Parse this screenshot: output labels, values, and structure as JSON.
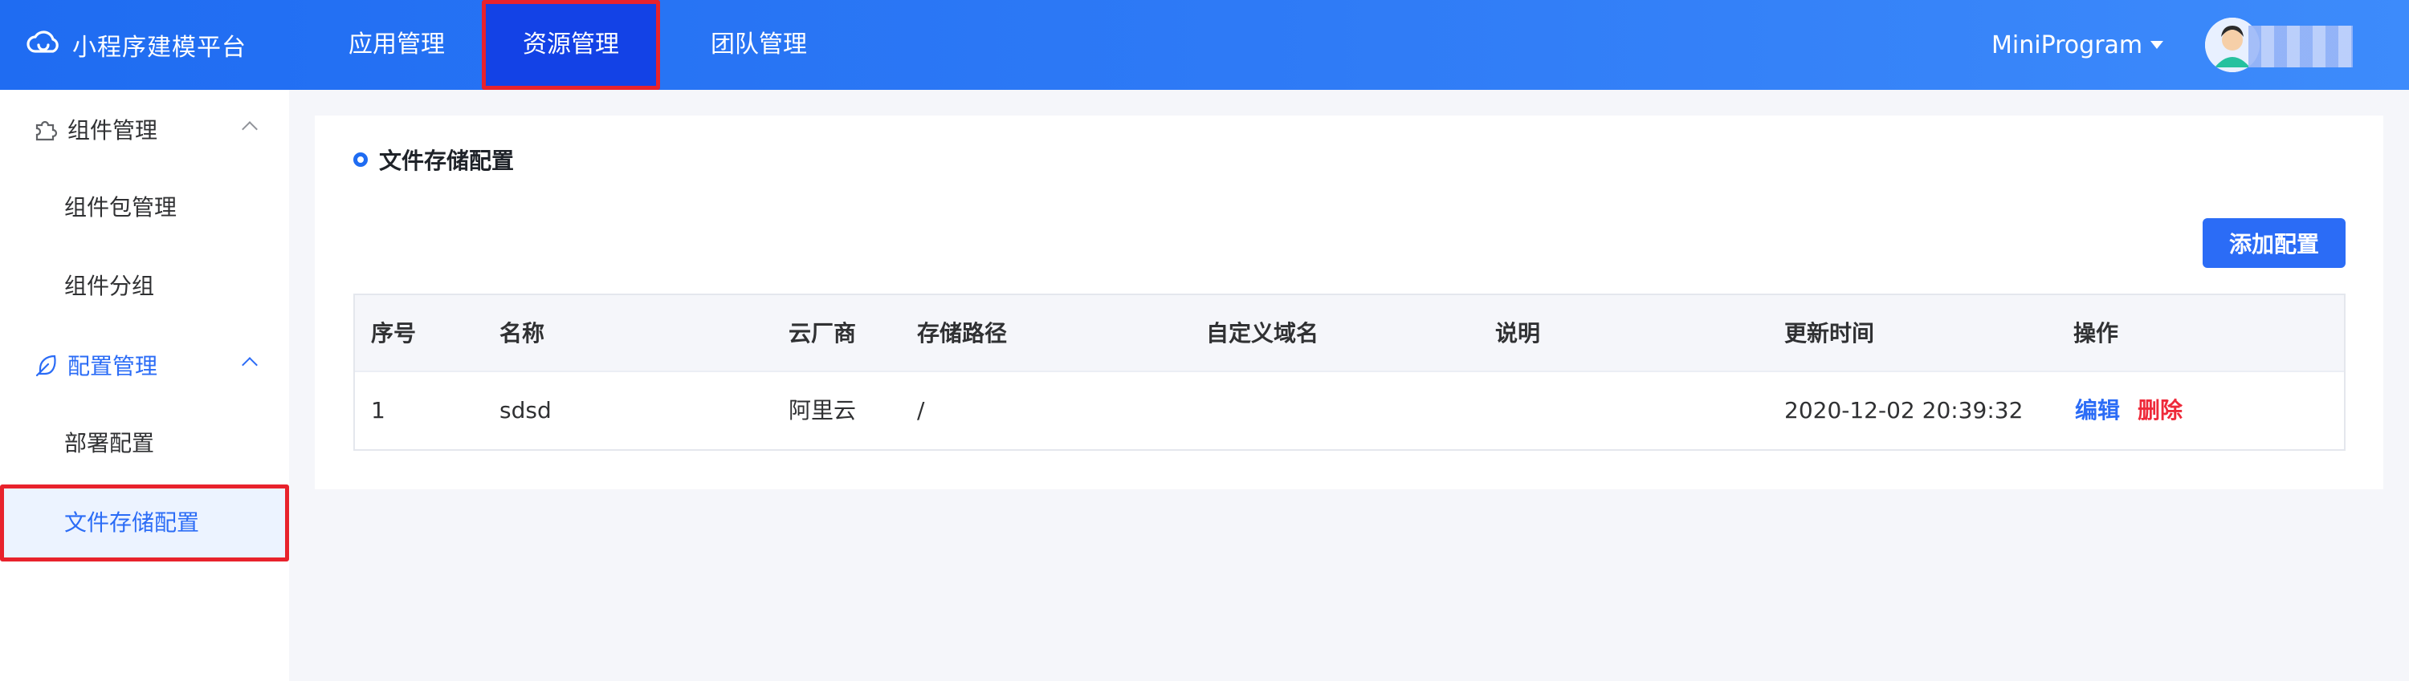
{
  "app": {
    "logo_text": "小程序建模平台"
  },
  "nav": {
    "items": [
      {
        "label": "应用管理"
      },
      {
        "label": "资源管理",
        "active": true
      },
      {
        "label": "团队管理"
      }
    ],
    "user_menu": "MiniProgram"
  },
  "sidebar": {
    "groups": [
      {
        "label": "组件管理",
        "icon": "puzzle-icon",
        "expanded": true,
        "items": [
          {
            "label": "组件包管理"
          },
          {
            "label": "组件分组"
          }
        ]
      },
      {
        "label": "配置管理",
        "icon": "feather-icon",
        "expanded": true,
        "items": [
          {
            "label": "部署配置"
          },
          {
            "label": "文件存储配置",
            "active": true
          }
        ]
      }
    ]
  },
  "main": {
    "title": "文件存储配置",
    "add_button": "添加配置",
    "table": {
      "columns": [
        "序号",
        "名称",
        "云厂商",
        "存储路径",
        "自定义域名",
        "说明",
        "更新时间",
        "操作"
      ],
      "rows": [
        {
          "index": "1",
          "name": "sdsd",
          "vendor": "阿里云",
          "path": "/",
          "domain": "",
          "desc": "",
          "updated": "2020-12-02 20:39:32",
          "actions": {
            "edit": "编辑",
            "delete": "删除"
          }
        }
      ]
    }
  },
  "colors": {
    "accent": "#2b6cf6",
    "header": "#1f6cf2",
    "active_nav": "#1342e6",
    "danger": "#ee2a3a",
    "highlight_box": "#e8222c"
  }
}
